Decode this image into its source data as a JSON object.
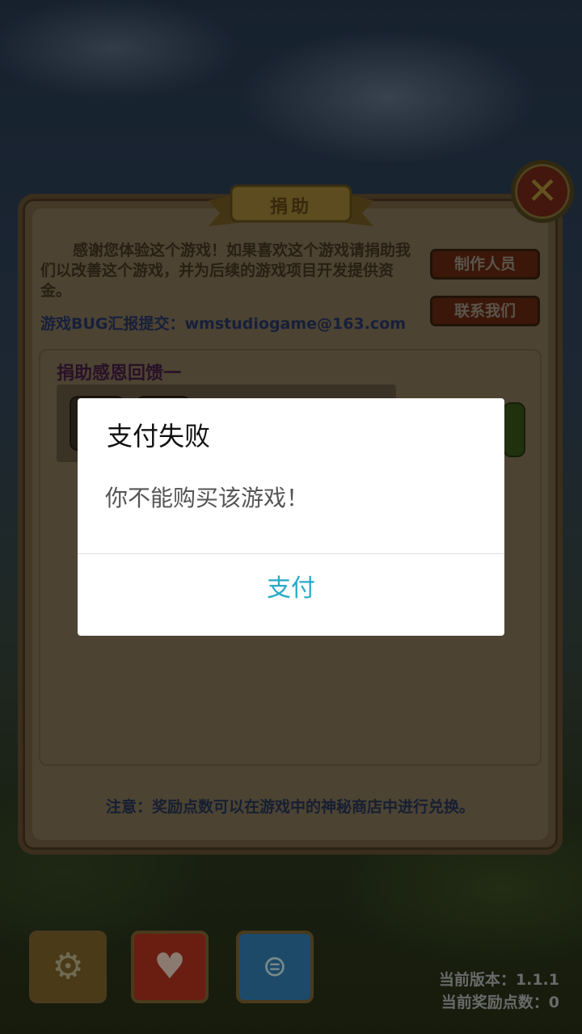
{
  "panel": {
    "title": "捐助",
    "intro": "感谢您体验这个游戏！如果喜欢这个游戏请捐助我们以改善这个游戏，并为后续的游戏项目开发提供资金。",
    "bug_report": "游戏BUG汇报提交：wmstudiogame@163.com",
    "credits_button": "制作人员",
    "contact_button": "联系我们",
    "reward_section_title": "捐助感恩回馈一",
    "notice": "注意：奖励点数可以在游戏中的神秘商店中进行兑换。"
  },
  "bottom_bar": {
    "icons": [
      "gear-icon",
      "heart-icon",
      "coin-icon"
    ],
    "version": "当前版本：1.1.1",
    "reward_points": "当前奖励点数：0"
  },
  "dialog": {
    "title": "支付失败",
    "message": "你不能购买该游戏！",
    "button": "支付"
  },
  "colors": {
    "dialog_button": "#27a9c9",
    "panel_bg": "#8b7a5e"
  }
}
